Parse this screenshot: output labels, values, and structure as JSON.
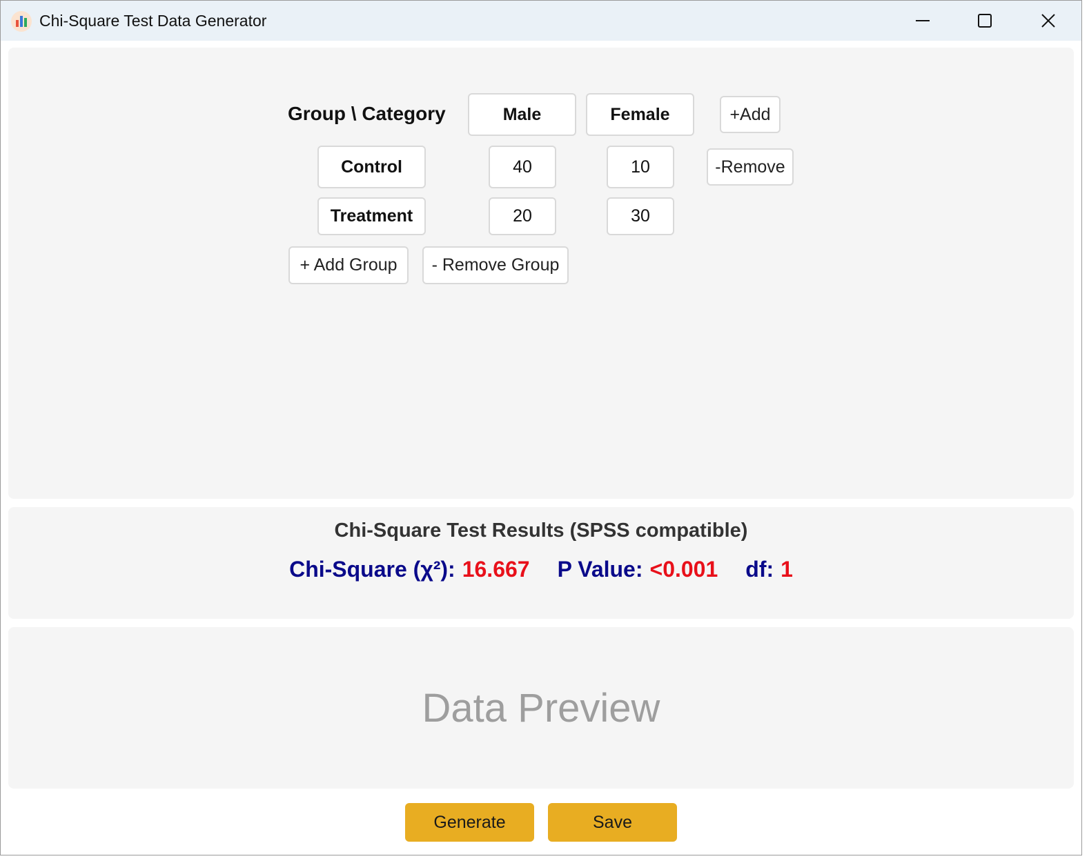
{
  "window": {
    "title": "Chi-Square Test Data Generator"
  },
  "table": {
    "corner_label": "Group \\ Category",
    "categories": [
      "Male",
      "Female"
    ],
    "add_category_label": "+Add",
    "remove_category_label": "-Remove",
    "groups": [
      {
        "name": "Control",
        "values": [
          "40",
          "10"
        ]
      },
      {
        "name": "Treatment",
        "values": [
          "20",
          "30"
        ]
      }
    ],
    "add_group_label": "+ Add Group",
    "remove_group_label": "- Remove Group"
  },
  "results": {
    "title": "Chi-Square Test Results (SPSS compatible)",
    "chi_square_label": "Chi-Square (χ²):",
    "chi_square_value": "16.667",
    "p_value_label": "P Value:",
    "p_value_value": "<0.001",
    "df_label": "df:",
    "df_value": "1",
    "label_color": "#0a0a8a",
    "value_color": "#e8101a"
  },
  "preview": {
    "placeholder": "Data Preview"
  },
  "actions": {
    "generate_label": "Generate",
    "save_label": "Save",
    "accent_color": "#e8ad22"
  }
}
